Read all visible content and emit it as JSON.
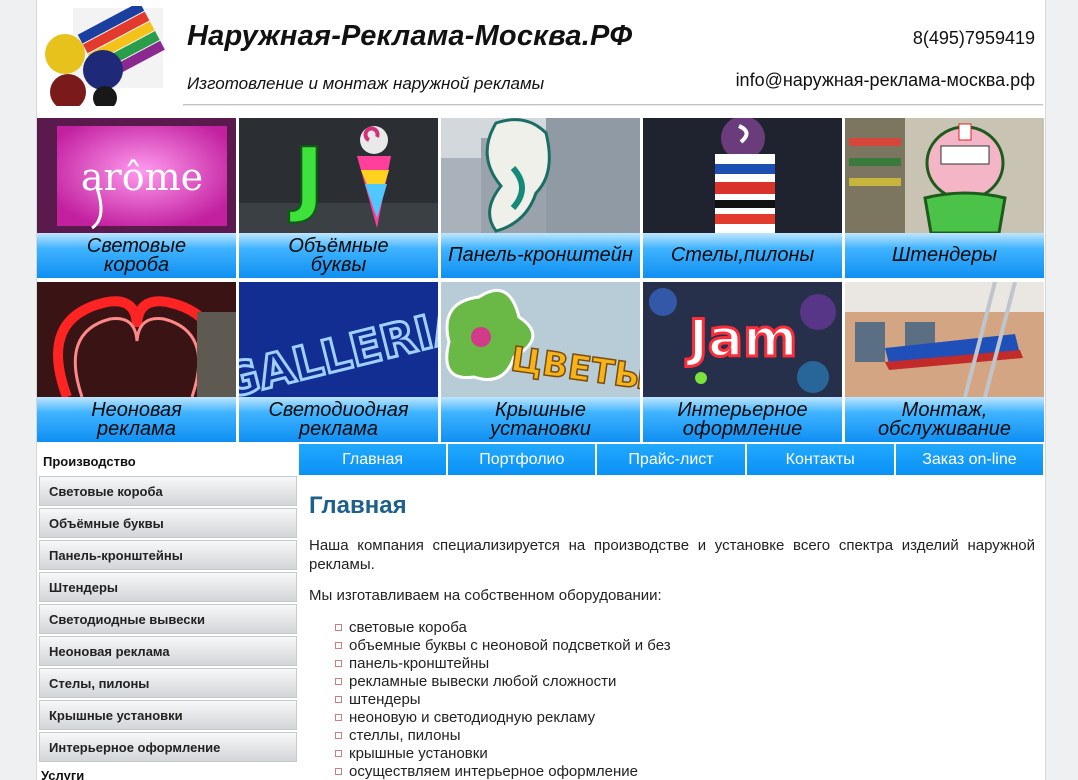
{
  "header": {
    "title": "Наружная-Реклама-Москва.РФ",
    "subtitle": "Изготовление и монтаж наружной рекламы",
    "phone": "8(495)7959419",
    "email": "info@наружная-реклама-москва.рф"
  },
  "tiles": [
    {
      "label": "Световые\nкороба",
      "icon": "lightbox-photo",
      "sign": "arôme"
    },
    {
      "label": "Объёмные\nбуквы",
      "icon": "3d-letters-photo",
      "sign": "J"
    },
    {
      "label": "Панель-кронштейн",
      "icon": "bracket-panel-photo",
      "sign": ""
    },
    {
      "label": "Стелы,пилоны",
      "icon": "pylon-photo",
      "sign": ""
    },
    {
      "label": "Штендеры",
      "icon": "sandwich-board-photo",
      "sign": ""
    },
    {
      "label": "Неоновая\nреклама",
      "icon": "neon-heart-photo",
      "sign": ""
    },
    {
      "label": "Светодиодная\nреклама",
      "icon": "led-sign-photo",
      "sign": "GALLERIA"
    },
    {
      "label": "Крышные\nустановки",
      "icon": "roof-sign-photo",
      "sign": "ЦВЕТЫ"
    },
    {
      "label": "Интерьерное\nоформление",
      "icon": "interior-sign-photo",
      "sign": "Jam"
    },
    {
      "label": "Монтаж,\nобслуживание",
      "icon": "installation-photo",
      "sign": ""
    }
  ],
  "sidebar": {
    "heading": "Производство",
    "items": [
      "Световые короба",
      "Объёмные буквы",
      "Панель-кронштейны",
      "Штендеры",
      "Светодиодные вывески",
      "Неоновая реклама",
      "Стелы, пилоны",
      "Крышные установки",
      "Интерьерное оформление"
    ],
    "heading2": "Услуги"
  },
  "nav": [
    "Главная",
    "Портфолио",
    "Прайс-лист",
    "Контакты",
    "Заказ on-line"
  ],
  "main": {
    "heading": "Главная",
    "intro": "Наша компания специализируется на производстве и установке всего спектра изделий наружной рекламы.",
    "lead": "Мы изготавливаем на собственном оборудовании:",
    "list": [
      "световые короба",
      "объемные буквы с неоновой подсветкой и без",
      "панель-кронштейны",
      "рекламные вывески любой сложности",
      "штендеры",
      "неоновую и светодиодную рекламу",
      "стеллы, пилоны",
      "крышные установки",
      "осуществляем интерьерное оформление"
    ]
  },
  "colors": {
    "nav_blue": "#0a91f5",
    "heading_blue": "#1f5f8b",
    "tile_band": "#0f8ff2"
  }
}
